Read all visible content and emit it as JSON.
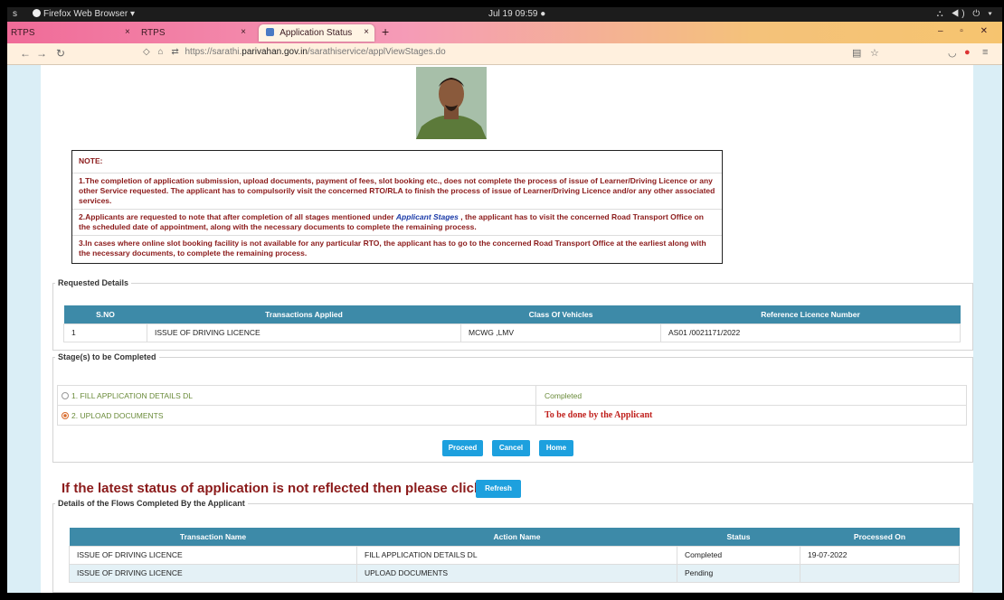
{
  "topbar": {
    "activities": "s",
    "app_menu": "Firefox Web Browser ▾",
    "clock": "Jul 19  09:59  ●",
    "tray": "⛬ ◀) ⏻ ▾"
  },
  "tabs": [
    {
      "label": "RTPS"
    },
    {
      "label": "RTPS"
    },
    {
      "label": "Application Status"
    }
  ],
  "toolbar": {
    "url_prefix": "https://sarathi.",
    "url_domain": "parivahan.gov.in",
    "url_path": "/sarathiservice/applViewStages.do"
  },
  "note": {
    "heading": "NOTE:",
    "p1": "1.The completion of application submission, upload documents, payment of fees, slot booking etc., does not complete the process of issue of Learner/Driving Licence or any other Service requested. The applicant has to compulsorily visit the concerned RTO/RLA to finish the process of issue of Learner/Driving Licence and/or any other associated services.",
    "p2_before": "2.Applicants are requested to note that after completion of all stages mentioned under ",
    "p2_link": "Applicant Stages",
    "p2_after": " , the applicant has to visit the concerned Road Transport Office on the scheduled date of appointment, along with the necessary documents to complete the remaining process.",
    "p3": "3.In cases where online slot booking facility is not available for any particular RTO, the applicant has to go to the concerned Road Transport Office at the earliest along with the necessary documents, to complete the remaining process."
  },
  "requested": {
    "legend": "Requested Details",
    "headers": [
      "S.NO",
      "Transactions Applied",
      "Class Of Vehicles",
      "Reference Licence Number"
    ],
    "rows": [
      [
        "1",
        "ISSUE OF DRIVING LICENCE",
        "MCWG ,LMV",
        "AS01 /0021171/2022"
      ]
    ]
  },
  "stages": {
    "legend": "Stage(s) to be Completed",
    "items": [
      {
        "label": "1. FILL APPLICATION DETAILS DL",
        "status": "Completed"
      },
      {
        "label": "2. UPLOAD DOCUMENTS",
        "status": "To be done by the Applicant"
      }
    ]
  },
  "buttons": {
    "proceed": "Proceed",
    "cancel": "Cancel",
    "home": "Home",
    "refresh": "Refresh"
  },
  "reflect_text": "If the latest status of application is not reflected then please click on",
  "flows": {
    "legend": "Details of the Flows Completed By the Applicant",
    "headers": [
      "Transaction Name",
      "Action Name",
      "Status",
      "Processed On"
    ],
    "rows": [
      [
        "ISSUE OF DRIVING LICENCE",
        "FILL APPLICATION DETAILS DL",
        "Completed",
        "19-07-2022"
      ],
      [
        "ISSUE OF DRIVING LICENCE",
        "UPLOAD DOCUMENTS",
        "Pending",
        ""
      ]
    ]
  }
}
